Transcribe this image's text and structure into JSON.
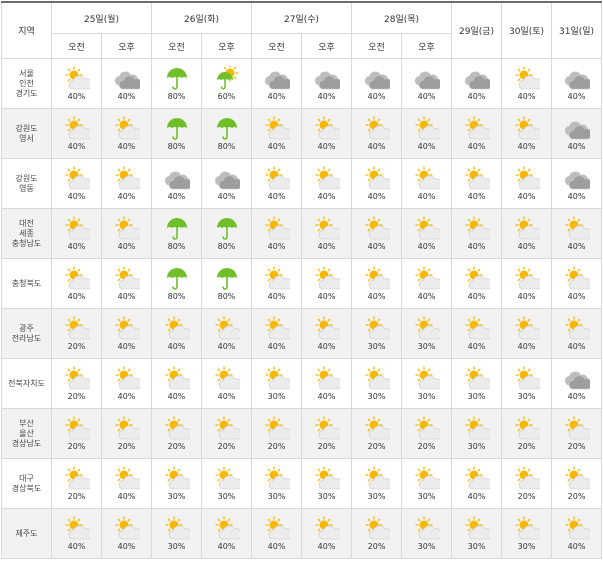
{
  "header": {
    "region_label": "지역",
    "days": [
      {
        "label": "25일(월)",
        "split": true
      },
      {
        "label": "26일(화)",
        "split": true
      },
      {
        "label": "27일(수)",
        "split": true
      },
      {
        "label": "28일(목)",
        "split": true
      },
      {
        "label": "29일(금)",
        "split": false
      },
      {
        "label": "30일(토)",
        "split": false
      },
      {
        "label": "31일(일)",
        "split": false
      }
    ],
    "am_label": "오전",
    "pm_label": "오후"
  },
  "rows": [
    {
      "region": [
        "서울",
        "인천",
        "경기도"
      ],
      "cells": [
        [
          "partly-cloudy-icon",
          "40%"
        ],
        [
          "cloudy-icon",
          "40%"
        ],
        [
          "umbrella-icon",
          "80%"
        ],
        [
          "shower-icon",
          "60%"
        ],
        [
          "cloudy-icon",
          "40%"
        ],
        [
          "cloudy-icon",
          "40%"
        ],
        [
          "cloudy-icon",
          "40%"
        ],
        [
          "cloudy-icon",
          "40%"
        ],
        [
          "cloudy-icon",
          "40%"
        ],
        [
          "partly-cloudy-icon",
          "40%"
        ],
        [
          "cloudy-icon",
          "40%"
        ]
      ]
    },
    {
      "region": [
        "강원도",
        "영서"
      ],
      "cells": [
        [
          "partly-cloudy-icon",
          "40%"
        ],
        [
          "partly-cloudy-icon",
          "40%"
        ],
        [
          "umbrella-icon",
          "80%"
        ],
        [
          "umbrella-icon",
          "80%"
        ],
        [
          "partly-cloudy-icon",
          "40%"
        ],
        [
          "partly-cloudy-icon",
          "40%"
        ],
        [
          "partly-cloudy-icon",
          "40%"
        ],
        [
          "partly-cloudy-icon",
          "40%"
        ],
        [
          "partly-cloudy-icon",
          "40%"
        ],
        [
          "partly-cloudy-icon",
          "40%"
        ],
        [
          "cloudy-icon",
          "40%"
        ]
      ]
    },
    {
      "region": [
        "강원도",
        "영동"
      ],
      "cells": [
        [
          "partly-cloudy-icon",
          "40%"
        ],
        [
          "partly-cloudy-icon",
          "40%"
        ],
        [
          "cloudy-icon",
          "40%"
        ],
        [
          "cloudy-icon",
          "40%"
        ],
        [
          "partly-cloudy-icon",
          "40%"
        ],
        [
          "partly-cloudy-icon",
          "40%"
        ],
        [
          "partly-cloudy-icon",
          "40%"
        ],
        [
          "partly-cloudy-icon",
          "40%"
        ],
        [
          "partly-cloudy-icon",
          "40%"
        ],
        [
          "partly-cloudy-icon",
          "40%"
        ],
        [
          "cloudy-icon",
          "40%"
        ]
      ]
    },
    {
      "region": [
        "대전",
        "세종",
        "충청남도"
      ],
      "cells": [
        [
          "partly-cloudy-icon",
          "40%"
        ],
        [
          "partly-cloudy-icon",
          "40%"
        ],
        [
          "umbrella-icon",
          "80%"
        ],
        [
          "umbrella-icon",
          "80%"
        ],
        [
          "partly-cloudy-icon",
          "40%"
        ],
        [
          "partly-cloudy-icon",
          "40%"
        ],
        [
          "partly-cloudy-icon",
          "40%"
        ],
        [
          "partly-cloudy-icon",
          "40%"
        ],
        [
          "partly-cloudy-icon",
          "40%"
        ],
        [
          "partly-cloudy-icon",
          "40%"
        ],
        [
          "partly-cloudy-icon",
          "40%"
        ]
      ]
    },
    {
      "region": [
        "충청북도"
      ],
      "cells": [
        [
          "partly-cloudy-icon",
          "40%"
        ],
        [
          "partly-cloudy-icon",
          "40%"
        ],
        [
          "umbrella-icon",
          "80%"
        ],
        [
          "umbrella-icon",
          "80%"
        ],
        [
          "partly-cloudy-icon",
          "40%"
        ],
        [
          "partly-cloudy-icon",
          "40%"
        ],
        [
          "partly-cloudy-icon",
          "40%"
        ],
        [
          "partly-cloudy-icon",
          "40%"
        ],
        [
          "partly-cloudy-icon",
          "40%"
        ],
        [
          "partly-cloudy-icon",
          "40%"
        ],
        [
          "partly-cloudy-icon",
          "40%"
        ]
      ]
    },
    {
      "region": [
        "광주",
        "전라남도"
      ],
      "cells": [
        [
          "partly-cloudy-icon",
          "20%"
        ],
        [
          "partly-cloudy-icon",
          "40%"
        ],
        [
          "partly-cloudy-icon",
          "40%"
        ],
        [
          "partly-cloudy-icon",
          "40%"
        ],
        [
          "partly-cloudy-icon",
          "40%"
        ],
        [
          "partly-cloudy-icon",
          "40%"
        ],
        [
          "partly-cloudy-icon",
          "30%"
        ],
        [
          "partly-cloudy-icon",
          "30%"
        ],
        [
          "partly-cloudy-icon",
          "40%"
        ],
        [
          "partly-cloudy-icon",
          "40%"
        ],
        [
          "partly-cloudy-icon",
          "40%"
        ]
      ]
    },
    {
      "region": [
        "전북자치도"
      ],
      "cells": [
        [
          "partly-cloudy-icon",
          "20%"
        ],
        [
          "partly-cloudy-icon",
          "40%"
        ],
        [
          "partly-cloudy-icon",
          "40%"
        ],
        [
          "partly-cloudy-icon",
          "40%"
        ],
        [
          "partly-cloudy-icon",
          "30%"
        ],
        [
          "partly-cloudy-icon",
          "40%"
        ],
        [
          "partly-cloudy-icon",
          "30%"
        ],
        [
          "partly-cloudy-icon",
          "30%"
        ],
        [
          "partly-cloudy-icon",
          "30%"
        ],
        [
          "partly-cloudy-icon",
          "30%"
        ],
        [
          "cloudy-icon",
          "40%"
        ]
      ]
    },
    {
      "region": [
        "부산",
        "울산",
        "경상남도"
      ],
      "cells": [
        [
          "partly-cloudy-icon",
          "20%"
        ],
        [
          "partly-cloudy-icon",
          "20%"
        ],
        [
          "partly-cloudy-icon",
          "20%"
        ],
        [
          "partly-cloudy-icon",
          "20%"
        ],
        [
          "partly-cloudy-icon",
          "20%"
        ],
        [
          "partly-cloudy-icon",
          "20%"
        ],
        [
          "partly-cloudy-icon",
          "20%"
        ],
        [
          "partly-cloudy-icon",
          "20%"
        ],
        [
          "partly-cloudy-icon",
          "30%"
        ],
        [
          "partly-cloudy-icon",
          "20%"
        ],
        [
          "partly-cloudy-icon",
          "20%"
        ]
      ]
    },
    {
      "region": [
        "대구",
        "경상북도"
      ],
      "cells": [
        [
          "partly-cloudy-icon",
          "20%"
        ],
        [
          "partly-cloudy-icon",
          "40%"
        ],
        [
          "partly-cloudy-icon",
          "30%"
        ],
        [
          "partly-cloudy-icon",
          "30%"
        ],
        [
          "partly-cloudy-icon",
          "30%"
        ],
        [
          "partly-cloudy-icon",
          "30%"
        ],
        [
          "partly-cloudy-icon",
          "30%"
        ],
        [
          "partly-cloudy-icon",
          "30%"
        ],
        [
          "partly-cloudy-icon",
          "40%"
        ],
        [
          "partly-cloudy-icon",
          "20%"
        ],
        [
          "partly-cloudy-icon",
          "20%"
        ]
      ]
    },
    {
      "region": [
        "제주도"
      ],
      "cells": [
        [
          "partly-cloudy-icon",
          "40%"
        ],
        [
          "partly-cloudy-icon",
          "40%"
        ],
        [
          "partly-cloudy-icon",
          "30%"
        ],
        [
          "partly-cloudy-icon",
          "40%"
        ],
        [
          "partly-cloudy-icon",
          "40%"
        ],
        [
          "partly-cloudy-icon",
          "40%"
        ],
        [
          "partly-cloudy-icon",
          "20%"
        ],
        [
          "partly-cloudy-icon",
          "30%"
        ],
        [
          "partly-cloudy-icon",
          "30%"
        ],
        [
          "partly-cloudy-icon",
          "30%"
        ],
        [
          "partly-cloudy-icon",
          "40%"
        ]
      ]
    }
  ],
  "colors": {
    "sun": "#f6b800",
    "cloud": "#a9a9a9",
    "umbrella": "#6fbf2b",
    "alt_row": "#f2f2f2",
    "border": "#d9d9d9"
  }
}
